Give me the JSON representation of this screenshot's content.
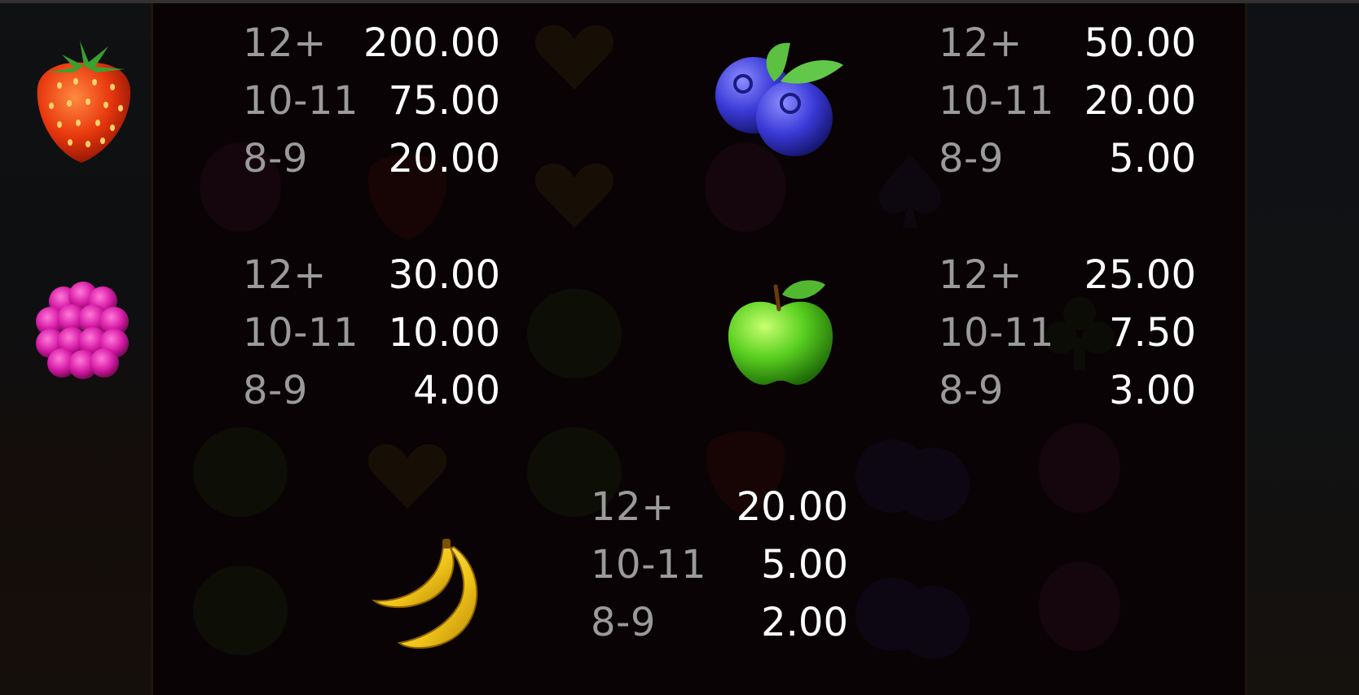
{
  "paytable": {
    "strawberry": {
      "icon": "strawberry-icon",
      "rows": [
        {
          "count": "12+",
          "payout": "200.00"
        },
        {
          "count": "10-11",
          "payout": "75.00"
        },
        {
          "count": "8-9",
          "payout": "20.00"
        }
      ]
    },
    "blueberry": {
      "icon": "blueberry-icon",
      "rows": [
        {
          "count": "12+",
          "payout": "50.00"
        },
        {
          "count": "10-11",
          "payout": "20.00"
        },
        {
          "count": "8-9",
          "payout": "5.00"
        }
      ]
    },
    "raspberry": {
      "icon": "raspberry-icon",
      "rows": [
        {
          "count": "12+",
          "payout": "30.00"
        },
        {
          "count": "10-11",
          "payout": "10.00"
        },
        {
          "count": "8-9",
          "payout": "4.00"
        }
      ]
    },
    "apple": {
      "icon": "apple-icon",
      "rows": [
        {
          "count": "12+",
          "payout": "25.00"
        },
        {
          "count": "10-11",
          "payout": "7.50"
        },
        {
          "count": "8-9",
          "payout": "3.00"
        }
      ]
    },
    "banana": {
      "icon": "banana-icon",
      "rows": [
        {
          "count": "12+",
          "payout": "20.00"
        },
        {
          "count": "10-11",
          "payout": "5.00"
        },
        {
          "count": "8-9",
          "payout": "2.00"
        }
      ]
    }
  },
  "colors": {
    "count_text": "#9a9a9a",
    "payout_text": "#ffffff",
    "background": "#0a0406"
  }
}
